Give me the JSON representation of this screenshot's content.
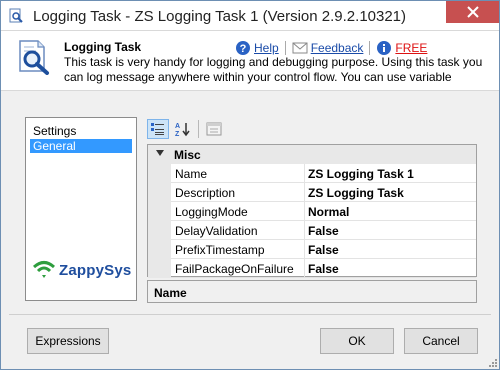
{
  "window": {
    "title": "Logging Task - ZS Logging Task 1 (Version 2.9.2.10321)",
    "title_icon": "magnifier-document-icon",
    "close_icon": "close-icon"
  },
  "header": {
    "title": "Logging Task",
    "description": "This task is very handy for logging and debugging purpose. Using this task you can log message anywhere within your control flow. You can use variable",
    "help_link": "Help",
    "feedback_link": "Feedback",
    "free_link": "FREE"
  },
  "nav": {
    "items": [
      {
        "label": "Settings",
        "selected": false
      },
      {
        "label": "General",
        "selected": true
      }
    ]
  },
  "logo": {
    "text": "ZappySys",
    "icon": "zappysys-wifi-logo"
  },
  "toolbar": {
    "categorized_icon": "categorized-view-icon",
    "alphabetical_icon": "sort-az-icon",
    "property_pages_icon": "property-pages-icon"
  },
  "property_grid": {
    "category": "Misc",
    "properties": [
      {
        "name": "Name",
        "value": "ZS Logging Task 1"
      },
      {
        "name": "Description",
        "value": "ZS Logging Task"
      },
      {
        "name": "LoggingMode",
        "value": "Normal"
      },
      {
        "name": "DelayValidation",
        "value": "False"
      },
      {
        "name": "PrefixTimestamp",
        "value": "False"
      },
      {
        "name": "FailPackageOnFailure",
        "value": "False"
      }
    ],
    "help_title": "Name"
  },
  "buttons": {
    "expressions": "Expressions",
    "ok": "OK",
    "cancel": "Cancel"
  },
  "colors": {
    "selection": "#3399ff",
    "close_button": "#c75050",
    "link": "#1a4ba8",
    "free_link": "#dd1111"
  }
}
